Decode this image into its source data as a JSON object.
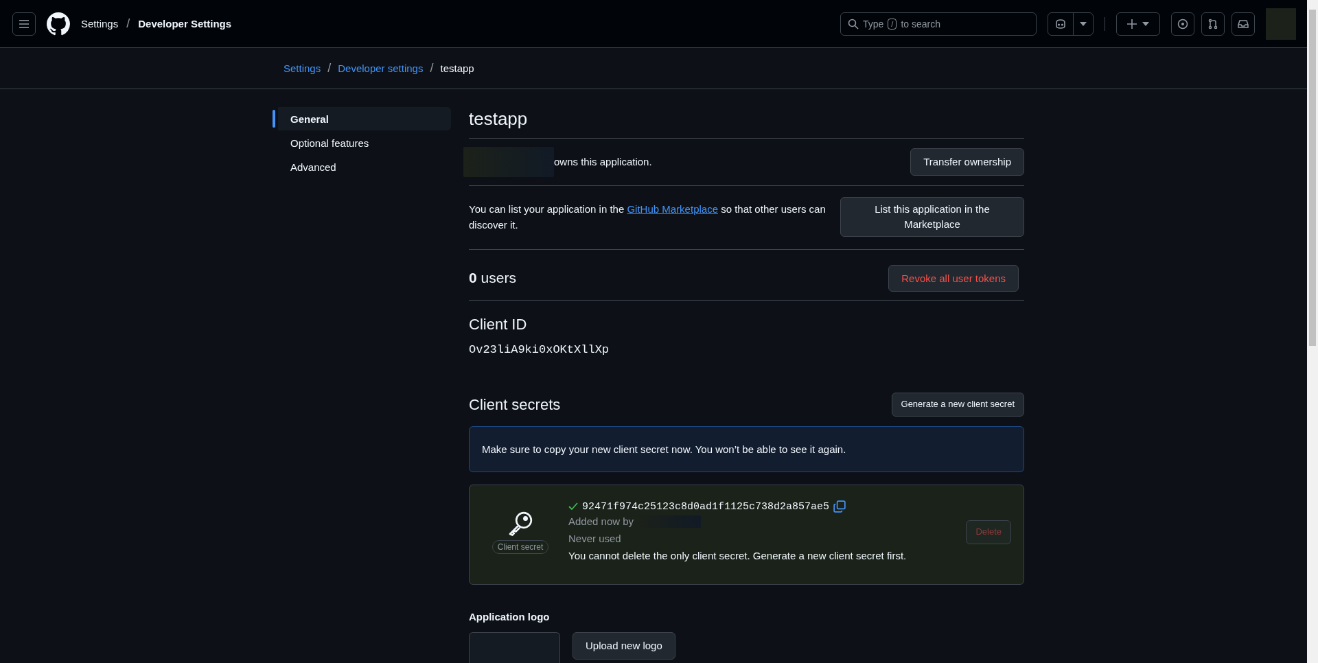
{
  "header": {
    "separator": "/",
    "breadcrumb": [
      {
        "label": "Settings",
        "current": false
      },
      {
        "label": "Developer Settings",
        "current": true
      }
    ],
    "search": {
      "before": "Type",
      "key": "/",
      "after": "to search"
    }
  },
  "breadcrumb": {
    "separator": "/",
    "items": [
      {
        "label": "Settings",
        "current": false
      },
      {
        "label": "Developer settings",
        "current": false
      },
      {
        "label": "testapp",
        "current": true
      }
    ]
  },
  "sidebar": {
    "items": [
      {
        "label": "General",
        "selected": true
      },
      {
        "label": "Optional features",
        "selected": false
      },
      {
        "label": "Advanced",
        "selected": false
      }
    ]
  },
  "title": "testapp",
  "owner": {
    "text": "owns this application.",
    "button": "Transfer ownership"
  },
  "marketplace": {
    "before": "You can list your application in the",
    "link": "GitHub Marketplace",
    "after": "so that other users can discover it.",
    "button": "List this application in the Marketplace"
  },
  "users": {
    "count": "0",
    "label": "users",
    "button": "Revoke all user tokens"
  },
  "client_id": {
    "title": "Client ID",
    "value": "Ov23liA9ki0xOKtXllXp"
  },
  "client_secrets": {
    "title": "Client secrets",
    "button": "Generate a new client secret",
    "notice": "Make sure to copy your new client secret now. You won’t be able to see it again.",
    "secret": {
      "badge": "Client secret",
      "value": "92471f974c25123c8d0ad1f1125c738d2a857ae5",
      "added": "Added now by",
      "used": "Never used",
      "warning": "You cannot delete the only client secret. Generate a new client secret first.",
      "delete": {
        "label": "Delete",
        "disabled": true
      }
    }
  },
  "logo": {
    "title": "Application logo",
    "button": "Upload new logo"
  }
}
